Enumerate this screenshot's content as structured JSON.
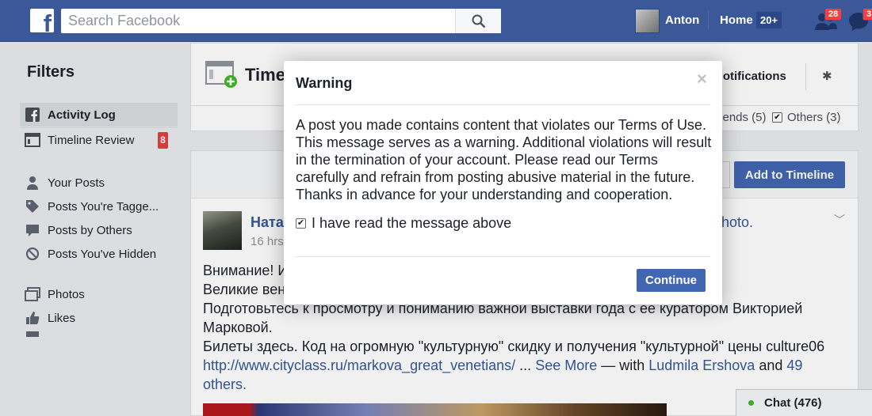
{
  "topbar": {
    "logo_letter": "f",
    "search_placeholder": "Search Facebook",
    "user_name": "Anton",
    "home_label": "Home",
    "home_count": "20+",
    "friend_requests_count": "28",
    "messages_count": "3"
  },
  "sidebar": {
    "title": "Filters",
    "items": [
      {
        "label": "Activity Log",
        "icon": "facebook-square-icon",
        "active": true
      },
      {
        "label": "Timeline Review",
        "icon": "timeline-review-icon",
        "badge": "8"
      },
      {
        "label": "Your Posts",
        "icon": "person-icon"
      },
      {
        "label": "Posts You're Tagge...",
        "icon": "tag-icon"
      },
      {
        "label": "Posts by Others",
        "icon": "speech-bubble-icon"
      },
      {
        "label": "Posts You've Hidden",
        "icon": "hidden-icon"
      },
      {
        "label": "Photos",
        "icon": "photos-icon"
      },
      {
        "label": "Likes",
        "icon": "thumbs-up-icon"
      }
    ]
  },
  "header": {
    "title": "Timeline Review",
    "notifications_label": "Notifications",
    "filter_friends": "Friends (5)",
    "filter_others": "Others (3)"
  },
  "actions": {
    "add_to_timeline": "Add to Timeline"
  },
  "post": {
    "author": "Наталья Черкасова",
    "time": "16 hrs",
    "photo_link": "photo.",
    "lines": [
      "Внимание! Из Венеции в Москву!",
      "Великие венецианцы в Пушкинском!",
      "Подготовьтесь к просмотру и пониманию важной выставки года с ее куратором Викторией",
      "Марковой.",
      "Билеты здесь. Код на огромную \"культурную\" скидку и получения \"культурной\" цены culture06"
    ],
    "url": "http://www.cityclass.ru/markova_great_venetians/",
    "ellipsis": " ... ",
    "see_more": "See More",
    "with_text": "  — with ",
    "tagged_name": "Ludmila Ershova",
    "and_text": " and ",
    "others_count": "49",
    "others_word": "others."
  },
  "chat": {
    "label": "Chat (476)"
  },
  "dialog": {
    "title": "Warning",
    "close_glyph": "×",
    "message": "A post you made contains content that violates our Terms of Use. This message serves as a warning. Additional violations will result in the termination of your account. Please read our Terms carefully and refrain from posting abusive material in the future. Thanks in advance for your understanding and cooperation.",
    "checkbox_label": "I have read the message above",
    "checkbox_checked": true,
    "continue_label": "Continue"
  },
  "colors": {
    "brand": "#3b5998",
    "button": "#4267b2",
    "link": "#365899",
    "badge": "#fa3e3e"
  }
}
